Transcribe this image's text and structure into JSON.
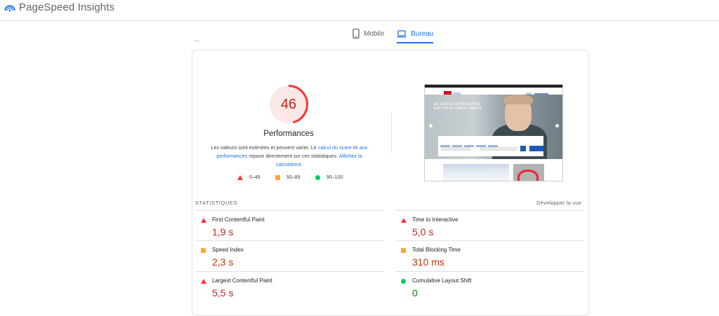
{
  "app": {
    "title": "PageSpeed Insights",
    "logo_icon": "pagespeed-logo-icon"
  },
  "tabs": [
    {
      "label": "Mobile",
      "icon": "phone-icon",
      "active": false
    },
    {
      "label": "Bureau",
      "icon": "laptop-icon",
      "active": true
    }
  ],
  "colors": {
    "accent": "#1a73e8",
    "fail": "#ff3333",
    "average": "#ffaa33",
    "pass": "#00cc66"
  },
  "performance": {
    "score": "46",
    "score_fraction": 0.46,
    "title": "Performances",
    "desc_part1": "Les valeurs sont estimées et peuvent varier. Le ",
    "desc_link1": "calcul du score lié aux performances",
    "desc_part2": " repose directement sur ces statistiques. ",
    "desc_link2": "Affichez la calculatrice",
    "desc_part3": "."
  },
  "legend": [
    {
      "range": "0–49",
      "icon": "triangle-icon"
    },
    {
      "range": "50–89",
      "icon": "square-icon"
    },
    {
      "range": "90–100",
      "icon": "circle-icon"
    }
  ],
  "thumbnail": {
    "hero_text": "100 EUROS DE RÉDUCTION SUR VOTRE CARTE LIBERTÉ"
  },
  "stats": {
    "label": "STATISTIQUES",
    "expand_label": "Développer la vue",
    "metrics": [
      {
        "name": "First Contentful Paint",
        "value": "1,9 s",
        "rating": "fail"
      },
      {
        "name": "Time to Interactive",
        "value": "5,0 s",
        "rating": "fail"
      },
      {
        "name": "Speed Index",
        "value": "2,3 s",
        "rating": "average"
      },
      {
        "name": "Total Blocking Time",
        "value": "310 ms",
        "rating": "average"
      },
      {
        "name": "Largest Contentful Paint",
        "value": "5,5 s",
        "rating": "fail"
      },
      {
        "name": "Cumulative Layout Shift",
        "value": "0",
        "rating": "pass"
      }
    ]
  }
}
